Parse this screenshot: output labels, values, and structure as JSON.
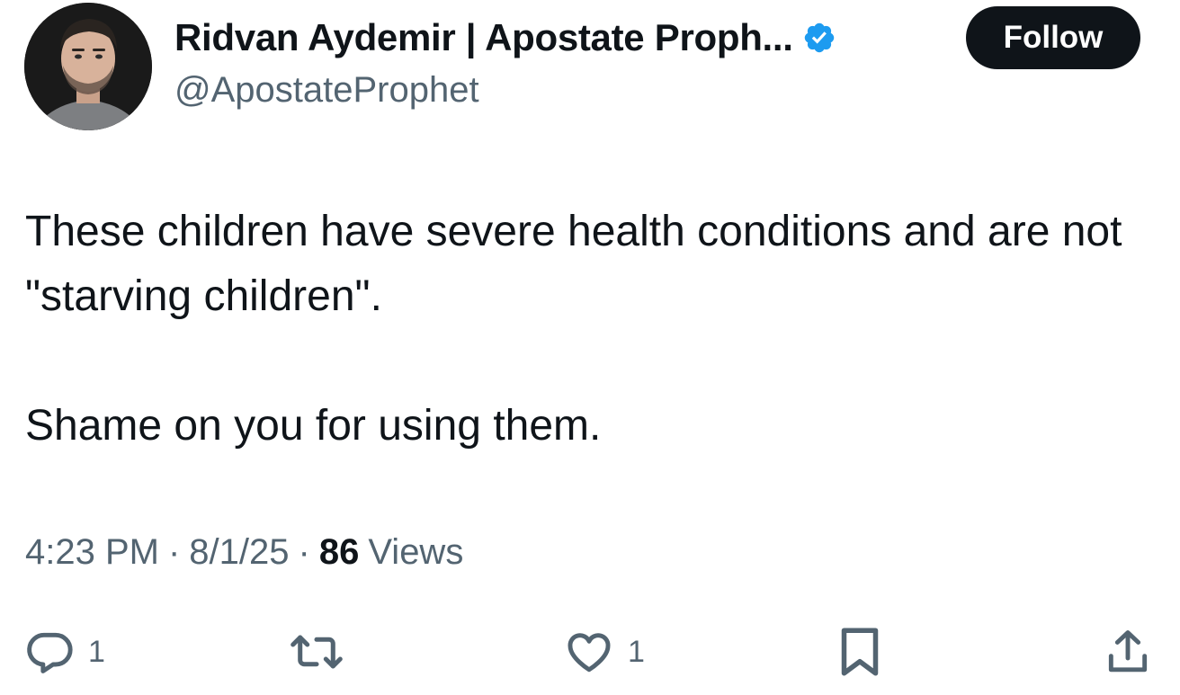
{
  "author": {
    "display_name": "Ridvan Aydemir | Apostate Proph...",
    "handle": "@ApostateProphet",
    "verified": true,
    "avatar_icon": "profile-photo"
  },
  "follow_button": {
    "label": "Follow"
  },
  "tweet": {
    "paragraphs": [
      "These children have severe health conditions and are not \"starving children\".",
      "Shame on you for using them."
    ]
  },
  "meta": {
    "time": "4:23 PM",
    "separator": "·",
    "date": "8/1/25",
    "views_count": "86",
    "views_label": "Views"
  },
  "actions": {
    "reply": {
      "icon": "reply-icon",
      "count": "1"
    },
    "retweet": {
      "icon": "retweet-icon",
      "count": ""
    },
    "like": {
      "icon": "heart-icon",
      "count": "1"
    },
    "bookmark": {
      "icon": "bookmark-icon"
    },
    "share": {
      "icon": "share-icon"
    }
  },
  "colors": {
    "text_primary": "#0f1419",
    "text_secondary": "#536471",
    "verified_blue": "#1d9bf0",
    "follow_bg": "#0f1419"
  }
}
